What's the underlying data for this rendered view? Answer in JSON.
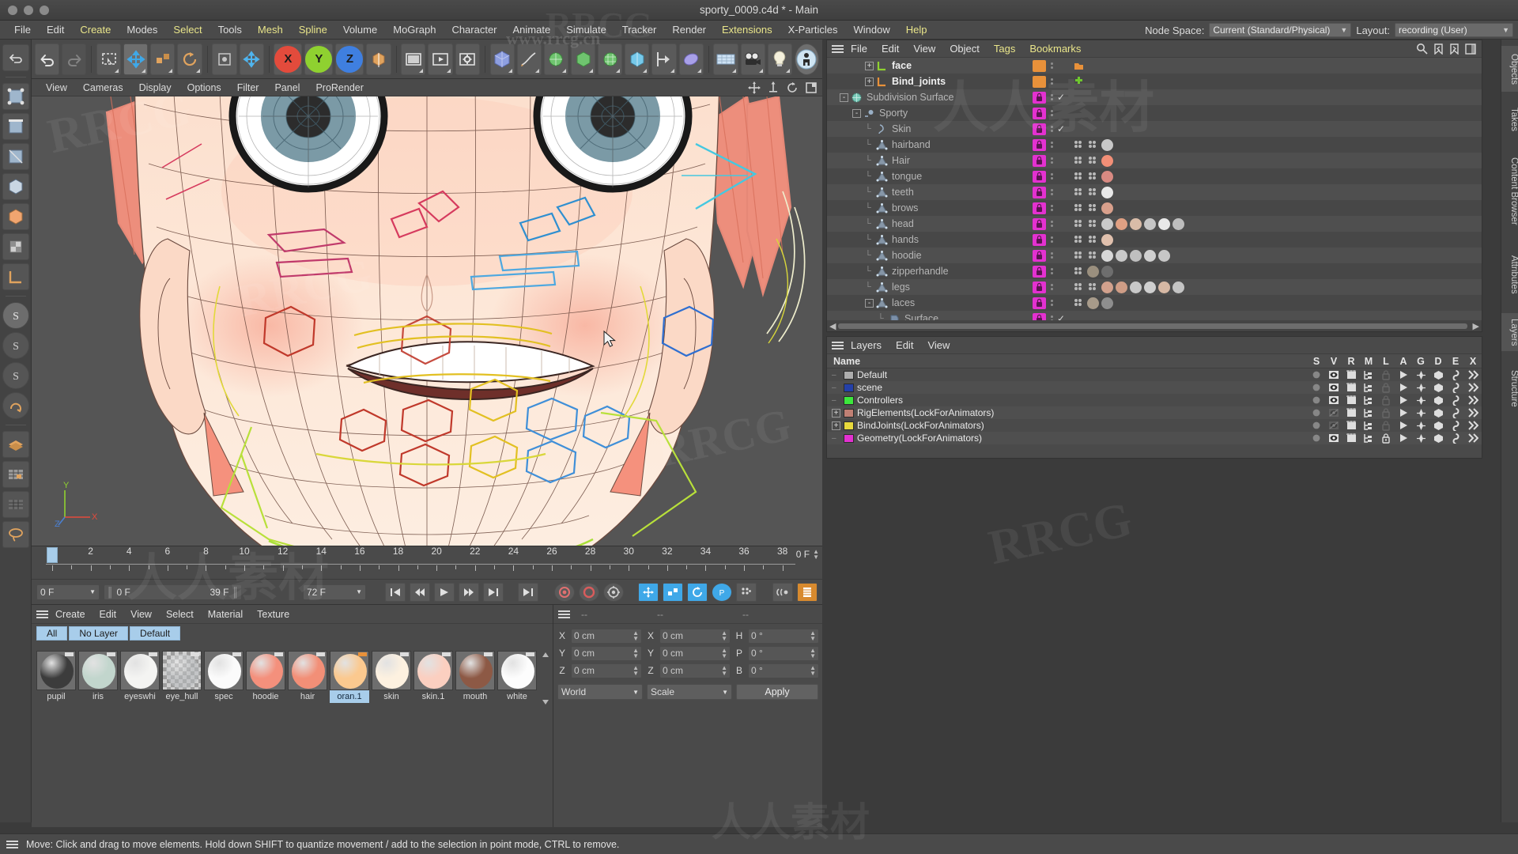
{
  "window": {
    "title": "sporty_0009.c4d * - Main",
    "traffic_lights": [
      "close",
      "minimize",
      "maximize"
    ]
  },
  "menubar": {
    "items": [
      {
        "label": "File",
        "highlight": false
      },
      {
        "label": "Edit",
        "highlight": false
      },
      {
        "label": "Create",
        "highlight": true
      },
      {
        "label": "Modes",
        "highlight": false
      },
      {
        "label": "Select",
        "highlight": true
      },
      {
        "label": "Tools",
        "highlight": false
      },
      {
        "label": "Mesh",
        "highlight": true
      },
      {
        "label": "Spline",
        "highlight": true
      },
      {
        "label": "Volume",
        "highlight": false
      },
      {
        "label": "MoGraph",
        "highlight": false
      },
      {
        "label": "Character",
        "highlight": false
      },
      {
        "label": "Animate",
        "highlight": false
      },
      {
        "label": "Simulate",
        "highlight": false
      },
      {
        "label": "Tracker",
        "highlight": false
      },
      {
        "label": "Render",
        "highlight": false
      },
      {
        "label": "Extensions",
        "highlight": true
      },
      {
        "label": "X-Particles",
        "highlight": false
      },
      {
        "label": "Window",
        "highlight": false
      },
      {
        "label": "Help",
        "highlight": true
      }
    ],
    "node_space_label": "Node Space:",
    "node_space_value": "Current (Standard/Physical)",
    "layout_label": "Layout:",
    "layout_value": "recording (User)"
  },
  "toolbar": {
    "axis_buttons": [
      {
        "label": "X",
        "color": "#e34b3c"
      },
      {
        "label": "Y",
        "color": "#8fd130"
      },
      {
        "label": "Z",
        "color": "#3f7fe0"
      }
    ],
    "icons": [
      "undo-icon",
      "redo-icon",
      "live-selection-icon",
      "move-icon",
      "scale-icon",
      "rotate-icon",
      "world-axis-icon",
      "render-view-icon",
      "render-region-icon",
      "render-settings-icon",
      "cube-icon",
      "spline-pen-icon",
      "nurbs-icon",
      "array-icon",
      "subdivision-icon",
      "deformer-icon",
      "mograph-icon",
      "scene-nodes-icon",
      "camera-icon",
      "light-icon",
      "character-icon"
    ]
  },
  "viewport": {
    "menu": [
      "View",
      "Cameras",
      "Display",
      "Options",
      "Filter",
      "Panel",
      "ProRender"
    ],
    "corner_icons": [
      "pan-icon",
      "zoom-icon",
      "rotate-icon",
      "maximize-icon"
    ],
    "axis_labels": {
      "x": "X",
      "y": "Y",
      "z": "Z"
    }
  },
  "timeline": {
    "ticks": [
      0,
      2,
      4,
      6,
      8,
      10,
      12,
      14,
      16,
      18,
      20,
      22,
      24,
      26,
      28,
      30,
      32,
      34,
      36,
      38
    ],
    "playhead_frame": 0,
    "current_frame_label": "0 F"
  },
  "transport": {
    "current_frame": "0 F",
    "range_start": "0 F",
    "range_end": "39 F",
    "max_frame": "72 F",
    "buttons": [
      "goto-start-icon",
      "step-back-icon",
      "play-icon",
      "step-forward-icon",
      "goto-end-icon",
      "next-key-icon",
      "record-active-objects-icon",
      "autokey-icon",
      "keyframe-settings-icon",
      "position-key-icon",
      "scale-key-icon",
      "rotation-key-icon",
      "param-key-icon",
      "pla-key-icon",
      "link-icon",
      "timeline-icon"
    ]
  },
  "material_manager": {
    "menu": [
      "Create",
      "Edit",
      "View",
      "Select",
      "Material",
      "Texture"
    ],
    "filters": [
      "All",
      "No Layer",
      "Default"
    ],
    "materials": [
      {
        "name": "pupil",
        "color": "#3c3c3c",
        "selected": false,
        "checker": false,
        "tag": "#dddddd"
      },
      {
        "name": "iris",
        "color": "#c2d6cd",
        "selected": false,
        "checker": false,
        "tag": "#dddddd"
      },
      {
        "name": "eyeswhi",
        "color": "#f4f4f2",
        "selected": false,
        "checker": false,
        "tag": "#dddddd"
      },
      {
        "name": "eye_hull",
        "color": "#b9bcbe",
        "selected": false,
        "checker": true,
        "tag": "#dddddd"
      },
      {
        "name": "spec",
        "color": "#fbfbfb",
        "selected": false,
        "checker": false,
        "tag": "#dddddd"
      },
      {
        "name": "hoodie",
        "color": "#f4907c",
        "selected": false,
        "checker": false,
        "tag": "#dddddd"
      },
      {
        "name": "hair",
        "color": "#f28f77",
        "selected": false,
        "checker": false,
        "tag": "#dddddd"
      },
      {
        "name": "oran.1",
        "color": "#fbc98f",
        "selected": true,
        "checker": false,
        "tag": "#e8913a"
      },
      {
        "name": "skin",
        "color": "#fdf1e0",
        "selected": false,
        "checker": false,
        "tag": "#dddddd"
      },
      {
        "name": "skin.1",
        "color": "#fbcfc0",
        "selected": false,
        "checker": false,
        "tag": "#dddddd"
      },
      {
        "name": "mouth",
        "color": "#8d5945",
        "selected": false,
        "checker": false,
        "tag": "#dddddd"
      },
      {
        "name": "white",
        "color": "#fdfdfd",
        "selected": false,
        "checker": false,
        "tag": "#dddddd"
      }
    ]
  },
  "coordinates": {
    "headers": [
      "--",
      "--",
      "--"
    ],
    "rows": [
      {
        "pos_label": "X",
        "pos_value": "0 cm",
        "size_label": "X",
        "size_value": "0 cm",
        "rot_label": "H",
        "rot_value": "0 °"
      },
      {
        "pos_label": "Y",
        "pos_value": "0 cm",
        "size_label": "Y",
        "size_value": "0 cm",
        "rot_label": "P",
        "rot_value": "0 °"
      },
      {
        "pos_label": "Z",
        "pos_value": "0 cm",
        "size_label": "Z",
        "size_value": "0 cm",
        "rot_label": "B",
        "rot_value": "0 °"
      }
    ],
    "space_value": "World",
    "mode_value": "Scale",
    "apply_label": "Apply"
  },
  "object_manager": {
    "menu": [
      "File",
      "Edit",
      "View",
      "Object",
      "Tags",
      "Bookmarks"
    ],
    "menu_highlight": [
      "Tags",
      "Bookmarks"
    ],
    "right_icons": [
      "search-icon",
      "bookmark-prev-icon",
      "bookmark-next-icon",
      "panel-icon"
    ],
    "rows": [
      {
        "name": "face",
        "indent": 3,
        "expander": "+",
        "icon": "null-axis-icon",
        "icon_color": "#8fd130",
        "color": "#e8913a",
        "dim": false,
        "tags": [
          "#e8913a"
        ],
        "check": false
      },
      {
        "name": "Bind_joints",
        "indent": 3,
        "expander": "+",
        "icon": "null-axis-icon",
        "icon_color": "#e8913a",
        "color": "#e8913a",
        "dim": false,
        "tags": [
          "#6ec72e"
        ],
        "check": false
      },
      {
        "name": "Subdivision Surface",
        "indent": 1,
        "expander": "-",
        "icon": "subdivision-icon",
        "icon_color": "#79c9b8",
        "color": "#e331d0",
        "dim": true,
        "tags": [],
        "check": true
      },
      {
        "name": "Sporty",
        "indent": 2,
        "expander": "-",
        "icon": "null-object-icon",
        "icon_color": "#9ab0c6",
        "color": "#e331d0",
        "dim": true,
        "tags": [],
        "check": false
      },
      {
        "name": "Skin",
        "indent": 3,
        "expander": "",
        "icon": "skin-deformer-icon",
        "icon_color": "#9ab0c6",
        "color": "#e331d0",
        "dim": true,
        "tags": [],
        "check": true
      },
      {
        "name": "hairband",
        "indent": 3,
        "expander": "",
        "icon": "polygon-icon",
        "icon_color": "#9ab0c6",
        "color": "#e331d0",
        "dim": true,
        "tags": [
          "#777777",
          "#777777",
          "#c8c8c8"
        ],
        "check": false
      },
      {
        "name": "Hair",
        "indent": 3,
        "expander": "",
        "icon": "polygon-icon",
        "icon_color": "#9ab0c6",
        "color": "#e331d0",
        "dim": true,
        "tags": [
          "#777777",
          "#777777",
          "#f28f77"
        ],
        "check": false
      },
      {
        "name": "tongue",
        "indent": 3,
        "expander": "",
        "icon": "polygon-icon",
        "icon_color": "#9ab0c6",
        "color": "#e331d0",
        "dim": true,
        "tags": [
          "#777777",
          "#777777",
          "#d98a82"
        ],
        "check": false
      },
      {
        "name": "teeth",
        "indent": 3,
        "expander": "",
        "icon": "polygon-icon",
        "icon_color": "#9ab0c6",
        "color": "#e331d0",
        "dim": true,
        "tags": [
          "#777777",
          "#777777",
          "#e9e9e9"
        ],
        "check": false
      },
      {
        "name": "brows",
        "indent": 3,
        "expander": "",
        "icon": "polygon-icon",
        "icon_color": "#9ab0c6",
        "color": "#e331d0",
        "dim": true,
        "tags": [
          "#777777",
          "#777777",
          "#d9a08c"
        ],
        "check": false
      },
      {
        "name": "head",
        "indent": 3,
        "expander": "",
        "icon": "polygon-icon",
        "icon_color": "#9ab0c6",
        "color": "#e331d0",
        "dim": true,
        "tags": [
          "#777777",
          "#777777",
          "#c9c9c9",
          "#e0a083",
          "#d9bca8",
          "#c6c6c6",
          "#e8e8e8",
          "#bdbdbd"
        ],
        "check": false
      },
      {
        "name": "hands",
        "indent": 3,
        "expander": "",
        "icon": "polygon-icon",
        "icon_color": "#9ab0c6",
        "color": "#e331d0",
        "dim": true,
        "tags": [
          "#777777",
          "#777777",
          "#e0c0ad"
        ],
        "check": false
      },
      {
        "name": "hoodie",
        "indent": 3,
        "expander": "",
        "icon": "polygon-icon",
        "icon_color": "#9ab0c6",
        "color": "#e331d0",
        "dim": true,
        "tags": [
          "#777777",
          "#777777",
          "#d8d8d8",
          "#c9c9c9",
          "#bfbfbf",
          "#d0d0d0",
          "#c7c7c7"
        ],
        "check": false
      },
      {
        "name": "zipperhandle",
        "indent": 3,
        "expander": "",
        "icon": "polygon-icon",
        "icon_color": "#9ab0c6",
        "color": "#e331d0",
        "dim": true,
        "tags": [
          "#777777",
          "#9a8f7e",
          "#6e6e6e"
        ],
        "check": false
      },
      {
        "name": "legs",
        "indent": 3,
        "expander": "",
        "icon": "polygon-icon",
        "icon_color": "#9ab0c6",
        "color": "#e331d0",
        "dim": true,
        "tags": [
          "#777777",
          "#777777",
          "#d2a18d",
          "#cf9d86",
          "#c8c8c8",
          "#cfcfcf",
          "#d6b8a4",
          "#c4c4c4"
        ],
        "check": false
      },
      {
        "name": "laces",
        "indent": 3,
        "expander": "-",
        "icon": "polygon-icon",
        "icon_color": "#9ab0c6",
        "color": "#e331d0",
        "dim": true,
        "tags": [
          "#777777",
          "#a89b8a",
          "#8e8e8e"
        ],
        "check": false
      },
      {
        "name": "Surface",
        "indent": 4,
        "expander": "",
        "icon": "material-tag-icon",
        "icon_color": "#7b8fa8",
        "color": "#e331d0",
        "dim": true,
        "tags": [],
        "check": true
      }
    ]
  },
  "layer_manager": {
    "menu": [
      "Layers",
      "Edit",
      "View"
    ],
    "columns": [
      "S",
      "V",
      "R",
      "M",
      "L",
      "A",
      "G",
      "D",
      "E",
      "X"
    ],
    "name_header": "Name",
    "rows": [
      {
        "name": "Default",
        "color": "#adadad",
        "expander": false,
        "visible": true,
        "locked": false
      },
      {
        "name": "scene",
        "color": "#2440a8",
        "expander": false,
        "visible": true,
        "locked": false
      },
      {
        "name": "Controllers",
        "color": "#3ce83c",
        "expander": false,
        "visible": true,
        "locked": false
      },
      {
        "name": "RigElements(LockForAnimators)",
        "color": "#c08074",
        "expander": true,
        "visible": false,
        "locked": false
      },
      {
        "name": "BindJoints(LockForAnimators)",
        "color": "#e8d93c",
        "expander": true,
        "visible": false,
        "locked": false
      },
      {
        "name": "Geometry(LockForAnimators)",
        "color": "#e331d0",
        "expander": false,
        "visible": true,
        "locked": true
      }
    ]
  },
  "right_rail": {
    "tabs": [
      "Objects",
      "Takes",
      "Content Browser",
      "Attributes",
      "Layers",
      "Structure"
    ]
  },
  "statusbar": {
    "message": "Move: Click and drag to move elements. Hold down SHIFT to quantize movement / add to the selection in point mode, CTRL to remove."
  },
  "colors": {
    "accent_orange": "#e8913a",
    "accent_magenta": "#e331d0",
    "accent_blue": "#a8cdea",
    "panel_bg": "#4a4a4a",
    "viewport_bg": "#555555"
  }
}
